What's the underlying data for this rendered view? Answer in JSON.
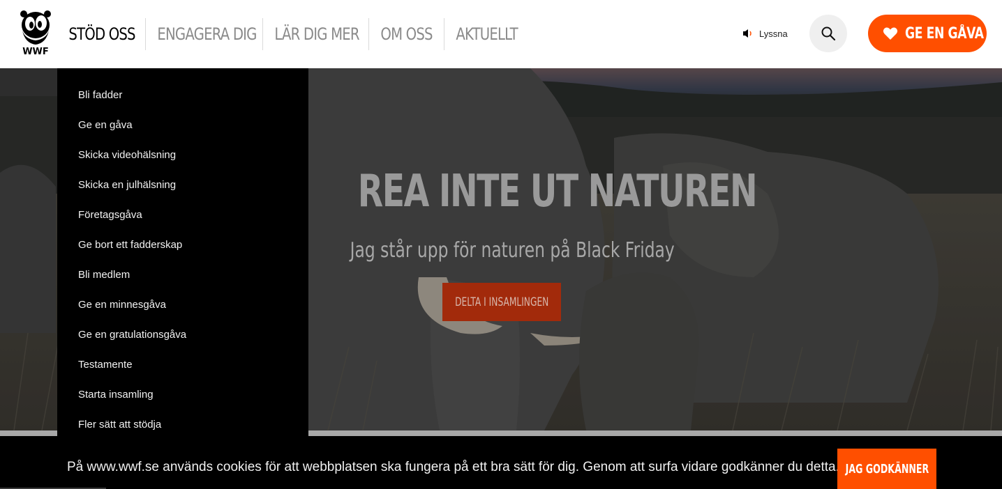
{
  "header": {
    "logo_text": "WWF",
    "nav": [
      {
        "label": "STÖD OSS",
        "active": true
      },
      {
        "label": "ENGAGERA DIG",
        "active": false
      },
      {
        "label": "LÄR DIG MER",
        "active": false
      },
      {
        "label": "OM OSS",
        "active": false
      },
      {
        "label": "AKTUELLT",
        "active": false
      }
    ],
    "listen_label": "Lyssna",
    "search_icon": "search-icon",
    "donate_label": "GE EN GÅVA",
    "donate_icon": "heart-icon"
  },
  "dropdown": {
    "items": [
      "Bli fadder",
      "Ge en gåva",
      "Skicka videohälsning",
      "Skicka en julhälsning",
      "Företagsgåva",
      "Ge bort ett fadderskap",
      "Bli medlem",
      "Ge en minnesgåva",
      "Ge en gratulationsgåva",
      "Testamente",
      "Starta insamling",
      "Fler sätt att stödja"
    ]
  },
  "hero": {
    "title": "REA INTE UT NATUREN",
    "subtitle": "Jag står upp för naturen på Black Friday",
    "cta_label": "DELTA I INSAMLINGEN"
  },
  "cookie": {
    "text": "På www.wwf.se används cookies för att webbplatsen ska fungera på ett bra sätt för dig. Genom att surfa vidare godkänner du detta.",
    "accept_label": "JAG GODKÄNNER"
  },
  "colors": {
    "brand_orange": "#ff4f00",
    "cta_dark_orange": "#a22a0b",
    "menu_black": "#000000"
  }
}
